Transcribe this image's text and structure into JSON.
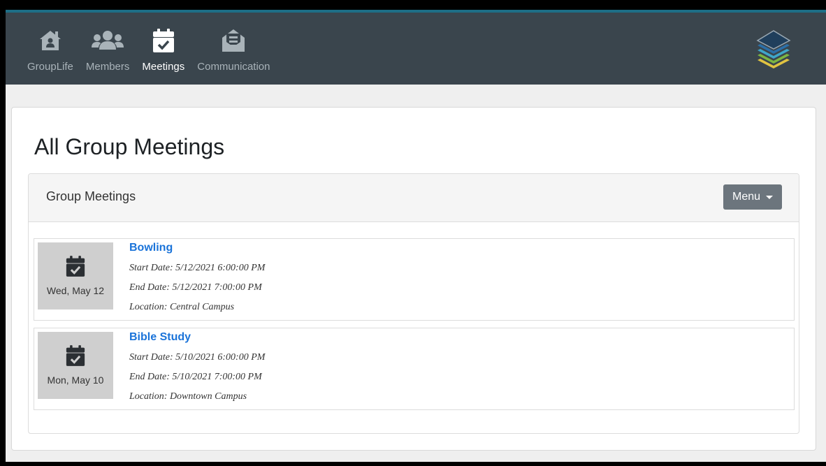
{
  "nav": {
    "items": [
      {
        "label": "GroupLife",
        "icon": "home-icon",
        "active": false
      },
      {
        "label": "Members",
        "icon": "users-icon",
        "active": false
      },
      {
        "label": "Meetings",
        "icon": "calendar-check-icon",
        "active": true
      },
      {
        "label": "Communication",
        "icon": "envelope-open-icon",
        "active": false
      }
    ]
  },
  "logo": {
    "icon": "layered-stack-logo"
  },
  "page": {
    "title": "All Group Meetings"
  },
  "panel": {
    "title": "Group Meetings",
    "menu_label": "Menu"
  },
  "meetings": [
    {
      "date": "Wed, May 12",
      "title": "Bowling",
      "start": "Start Date: 5/12/2021 6:00:00 PM",
      "end": "End Date: 5/12/2021 7:00:00 PM",
      "location": "Location: Central Campus"
    },
    {
      "date": "Mon, May 10",
      "title": "Bible Study",
      "start": "Start Date: 5/10/2021 6:00:00 PM",
      "end": "End Date: 5/10/2021 7:00:00 PM",
      "location": "Location: Downtown Campus"
    }
  ],
  "colors": {
    "topbar": "#3a454d",
    "accent": "#1d6e86",
    "link": "#1a73d9",
    "button": "#6c757d"
  }
}
